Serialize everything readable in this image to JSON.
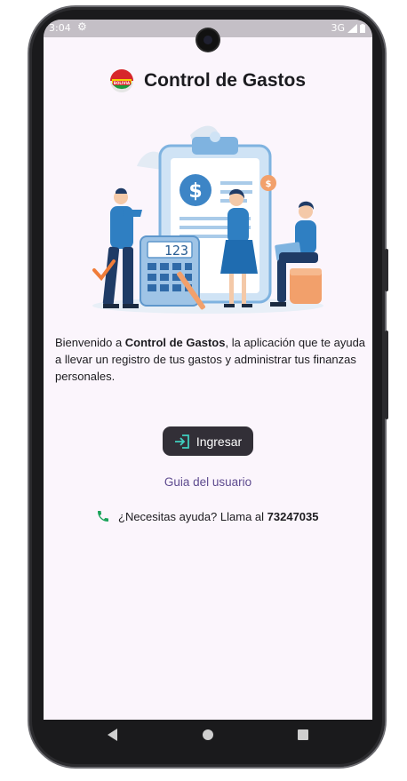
{
  "status_bar": {
    "time": "3:04",
    "network": "3G"
  },
  "app": {
    "title": "Control de Gastos",
    "logo_text": "BOLIVIA"
  },
  "illustration": {
    "calculator_display": "123"
  },
  "welcome": {
    "prefix": "Bienvenido a ",
    "app_name": "Control de Gastos",
    "suffix": ", la aplicación que te ayuda a llevar un registro de tus gastos y administrar tus finanzas personales."
  },
  "login_button": {
    "label": "Ingresar",
    "icon": "login-icon"
  },
  "guide_link": {
    "label": "Guia del usuario"
  },
  "help": {
    "text": "¿Necesitas ayuda? Llama al ",
    "phone": "73247035",
    "icon": "phone-icon"
  },
  "colors": {
    "background": "#fbf5fc",
    "button": "#322f37",
    "link": "#5e4b8f",
    "phone_icon": "#1aa35a"
  }
}
